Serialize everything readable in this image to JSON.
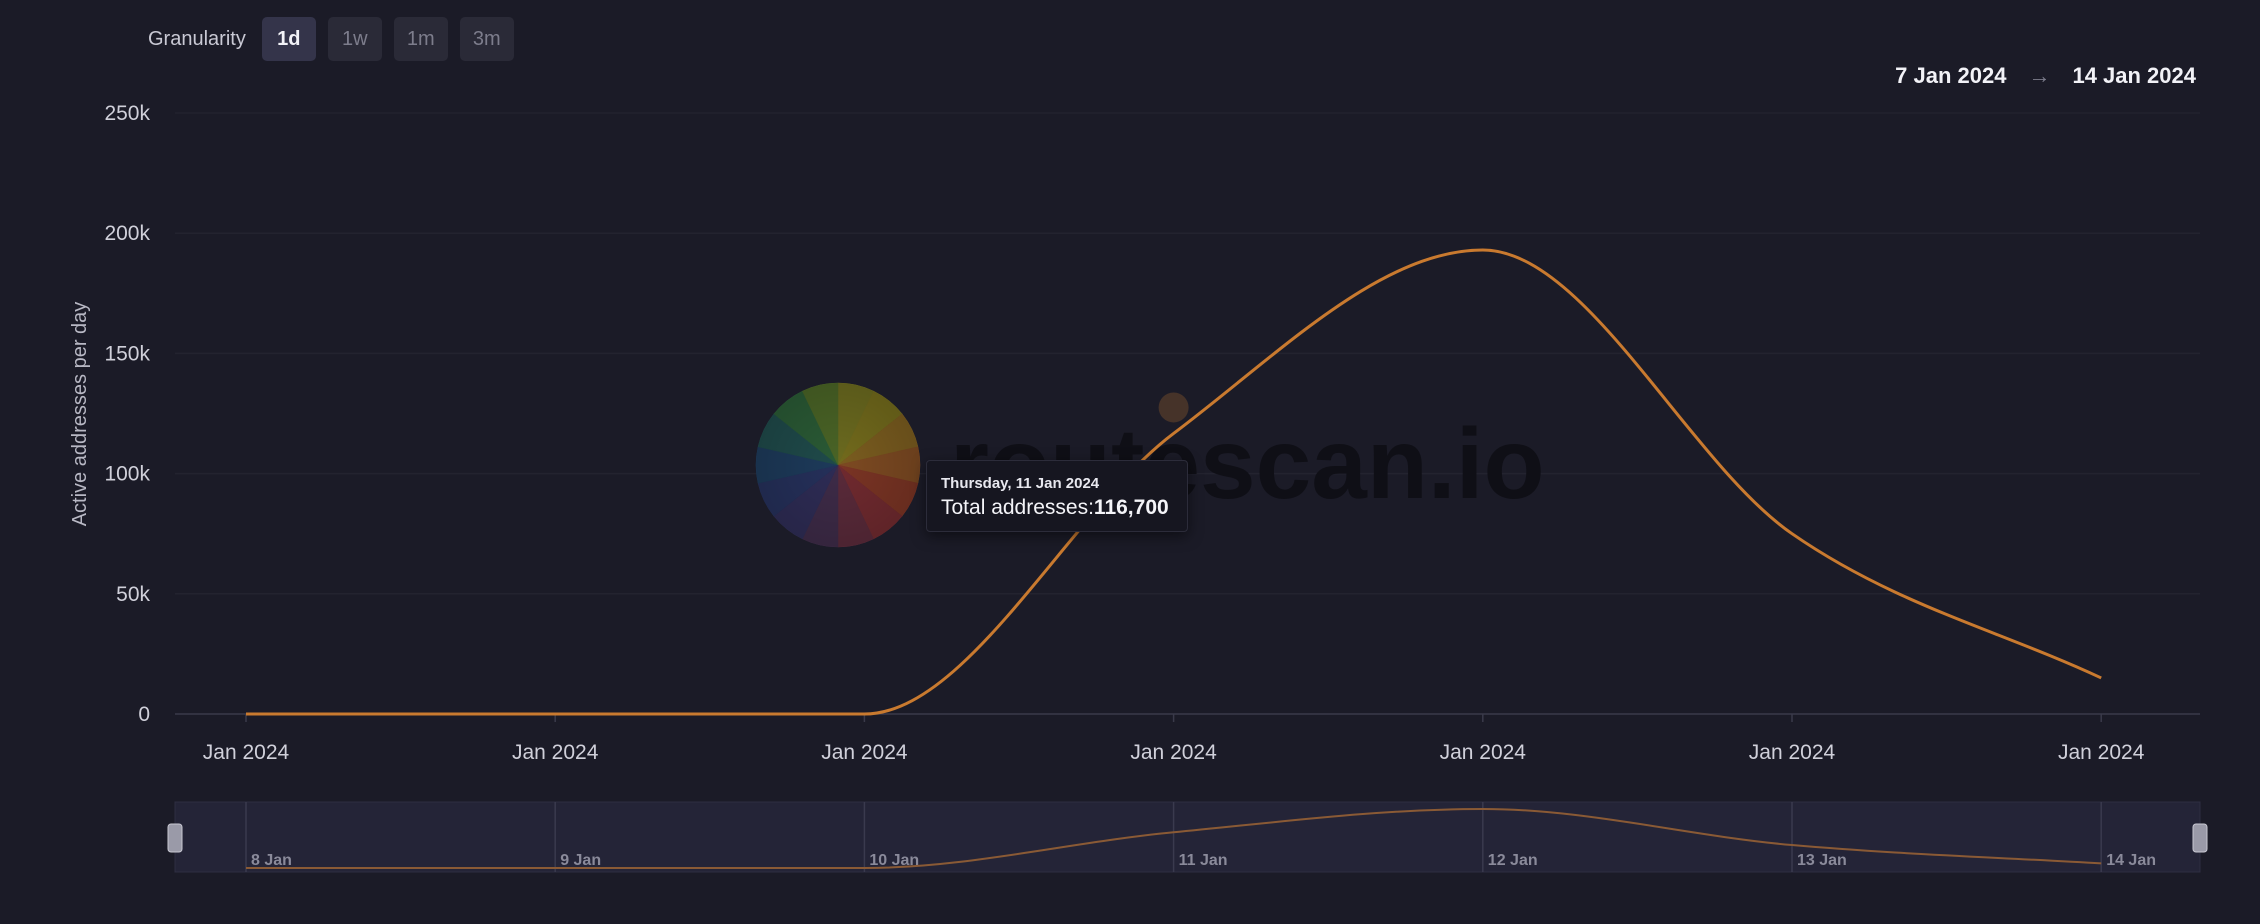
{
  "toolbar": {
    "granularity_label": "Granularity",
    "options": [
      {
        "label": "1d",
        "active": true
      },
      {
        "label": "1w",
        "active": false
      },
      {
        "label": "1m",
        "active": false
      },
      {
        "label": "3m",
        "active": false
      }
    ]
  },
  "date_range": {
    "start": "7 Jan 2024",
    "arrow": "→",
    "end": "14 Jan 2024"
  },
  "watermark": "routescan.io",
  "tooltip": {
    "date": "Thursday, 11 Jan 2024",
    "series_label": "Total addresses:",
    "value_text": "116,700"
  },
  "chart_data": {
    "type": "line",
    "title": "",
    "ylabel": "Active addresses per day",
    "xlabel": "",
    "x": [
      "2024-01-08",
      "2024-01-09",
      "2024-01-10",
      "2024-01-11",
      "2024-01-12",
      "2024-01-13",
      "2024-01-14"
    ],
    "x_tick_labels": [
      "Jan 2024",
      "Jan 2024",
      "Jan 2024",
      "Jan 2024",
      "Jan 2024",
      "Jan 2024",
      "Jan 2024"
    ],
    "series": [
      {
        "values": [
          0,
          0,
          0,
          116700,
          193000,
          75000,
          15000
        ],
        "color": "#c97a2f"
      }
    ],
    "ylim": [
      0,
      250000
    ],
    "y_ticks": [
      0,
      50000,
      100000,
      150000,
      200000,
      250000
    ],
    "y_tick_labels": [
      "0",
      "50k",
      "100k",
      "150k",
      "200k",
      "250k"
    ],
    "grid": true,
    "highlight": {
      "x": "2024-01-11",
      "value": 116700
    },
    "navigator_labels": [
      "8 Jan",
      "9 Jan",
      "10 Jan",
      "11 Jan",
      "12 Jan",
      "13 Jan",
      "14 Jan"
    ]
  }
}
